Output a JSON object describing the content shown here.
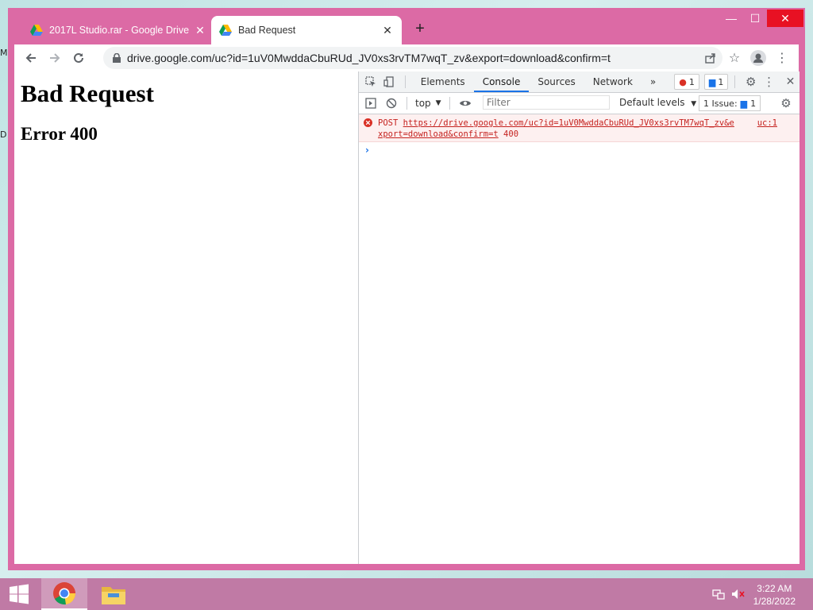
{
  "desktop": {
    "frag_top": "M",
    "frag_mid": "D"
  },
  "tabs": [
    {
      "title": "2017L Studio.rar - Google Drive",
      "active": false
    },
    {
      "title": "Bad Request",
      "active": true
    }
  ],
  "window_controls": {
    "minimize": "—",
    "maximize": "☐",
    "close": "✕"
  },
  "omnibox": {
    "url": "drive.google.com/uc?id=1uV0MwddaCbuRUd_JV0xs3rvTM7wqT_zv&export=download&confirm=t"
  },
  "page": {
    "heading": "Bad Request",
    "subheading": "Error 400"
  },
  "devtools": {
    "tabs": [
      "Elements",
      "Console",
      "Sources",
      "Network"
    ],
    "active_tab": "Console",
    "more": "»",
    "error_count": "1",
    "message_count": "1",
    "context": "top",
    "filter_placeholder": "Filter",
    "levels": "Default levels",
    "issues": "1 Issue:",
    "issues_count": "1",
    "error": {
      "method": "POST",
      "url_part1": "https://drive.google.com/uc?id=1uV0MwddaCbuRUd_JV0xs3rvTM7wqT_zv&e",
      "url_part2": "xport=download&confirm=t",
      "status": "400",
      "source": "uc:1"
    },
    "prompt": "›"
  },
  "taskbar": {
    "time": "3:22 AM",
    "date": "1/28/2022"
  },
  "colors": {
    "frame": "#dc6aa5",
    "taskbar": "#c07aa5",
    "error_red": "#c5221f",
    "accent_blue": "#1a73e8"
  }
}
